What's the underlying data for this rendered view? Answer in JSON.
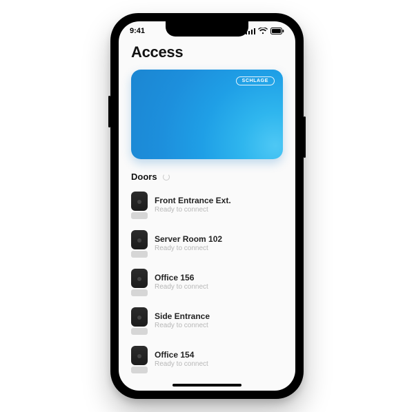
{
  "statusbar": {
    "time": "9:41"
  },
  "page": {
    "title": "Access"
  },
  "card": {
    "brand": "SCHLAGE"
  },
  "doors": {
    "heading": "Doors",
    "items": [
      {
        "name": "Front Entrance Ext.",
        "status": "Ready to connect"
      },
      {
        "name": "Server Room 102",
        "status": "Ready to connect"
      },
      {
        "name": "Office 156",
        "status": "Ready to connect"
      },
      {
        "name": "Side Entrance",
        "status": "Ready to connect"
      },
      {
        "name": "Office 154",
        "status": "Ready to connect"
      }
    ]
  }
}
